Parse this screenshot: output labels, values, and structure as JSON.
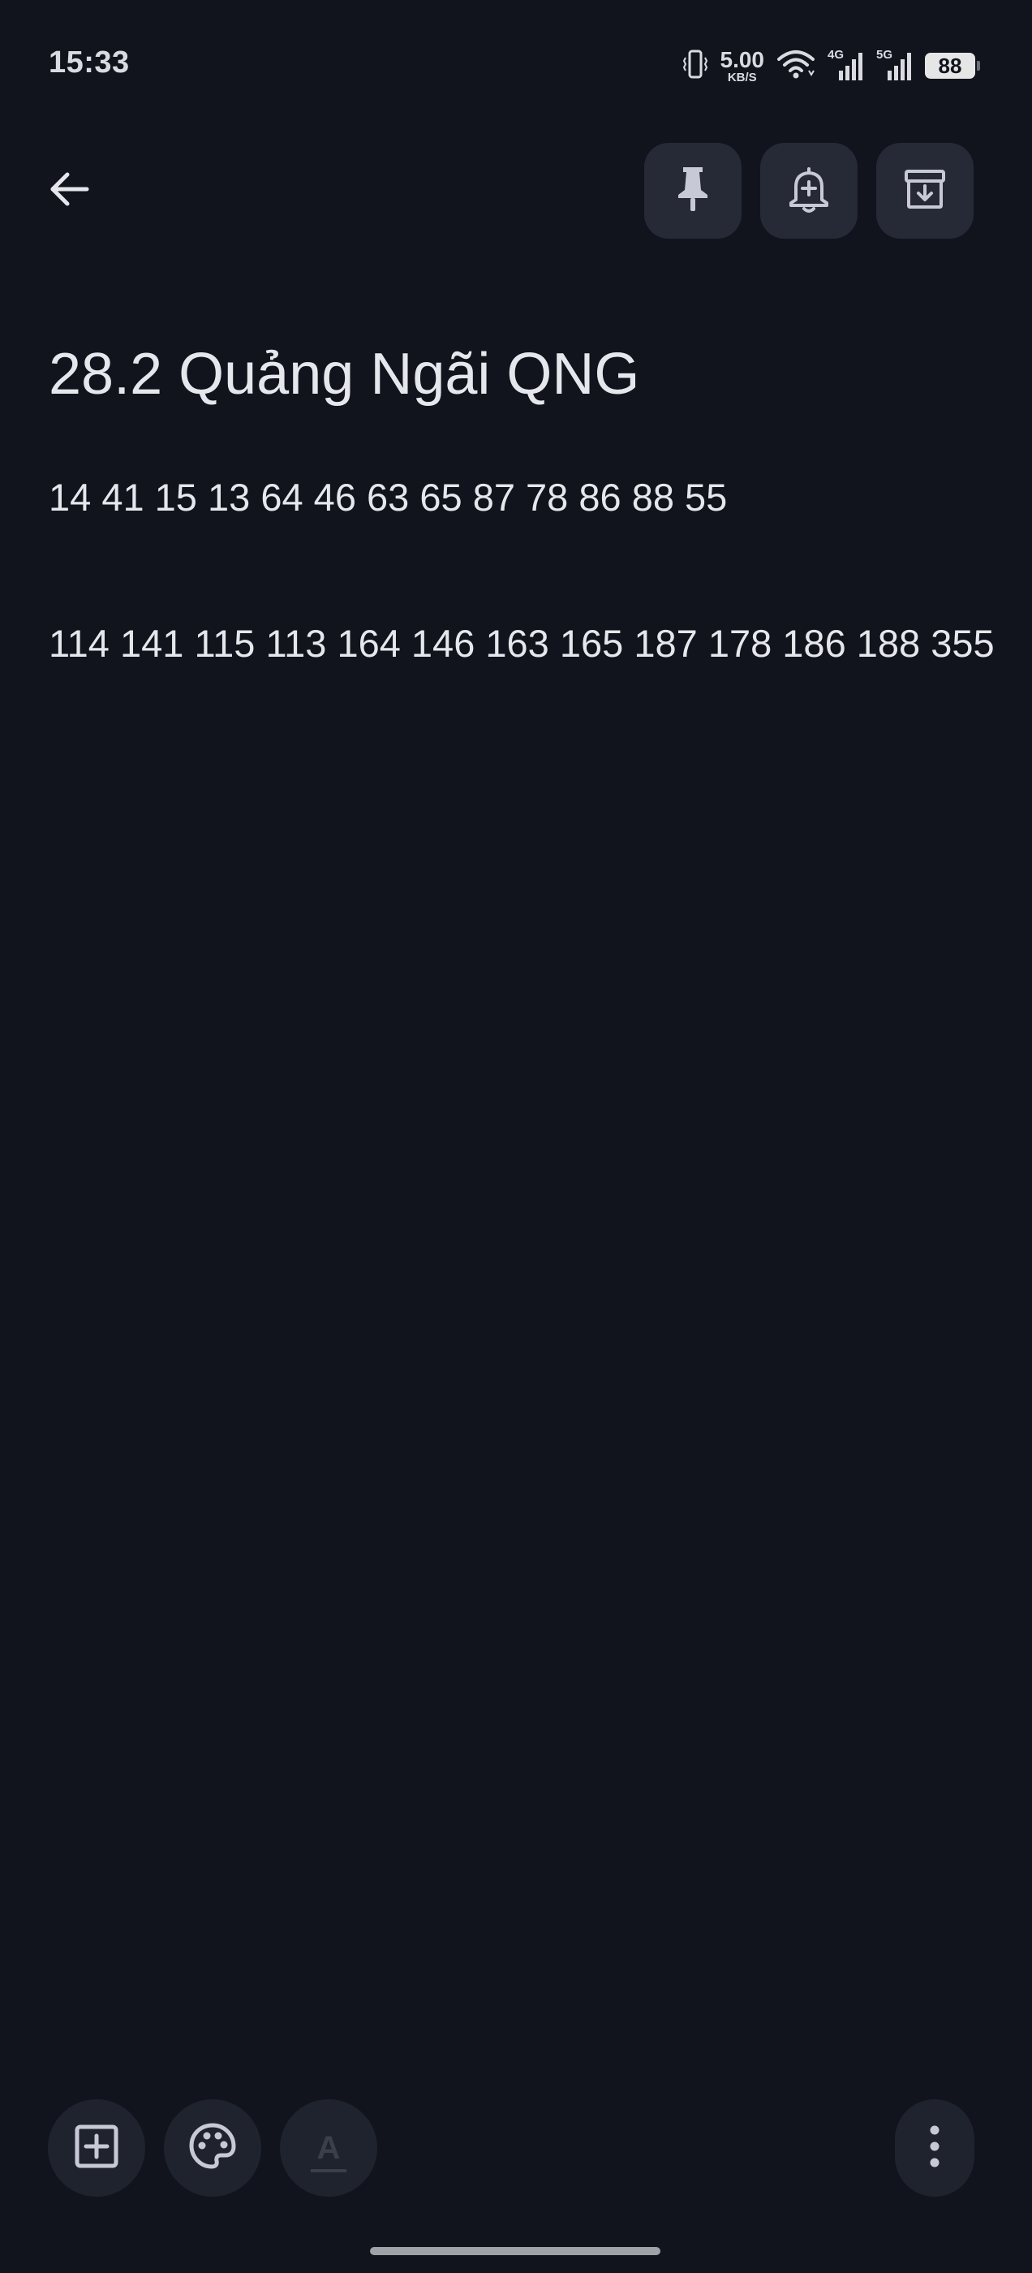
{
  "status_bar": {
    "time": "15:33",
    "speed_value": "5.00",
    "speed_unit": "KB/S",
    "network_4g": "4G",
    "network_5g": "5G",
    "battery": "88",
    "icons": [
      "vibrate-icon",
      "wifi-icon",
      "signal-4g-icon",
      "signal-5g-icon",
      "battery-icon"
    ]
  },
  "top_bar": {
    "back_icon": "arrow-back-icon",
    "actions": [
      "pin-icon",
      "add-reminder-icon",
      "archive-icon"
    ]
  },
  "note": {
    "title": "28.2 Quảng Ngãi QNG",
    "lines": [
      "14 41 15 13 64 46 63 65 87 78 86 88 55",
      "114 141 115 113 164 146 163 165 187 178 186 188 355"
    ]
  },
  "bottom_bar": {
    "format_label": "A",
    "icons": [
      "add-box-icon",
      "palette-icon",
      "text-format-icon",
      "more-vert-icon"
    ]
  },
  "colors": {
    "background": "#11141d",
    "button_surface": "#262a36",
    "text": "#e6e7ec"
  }
}
